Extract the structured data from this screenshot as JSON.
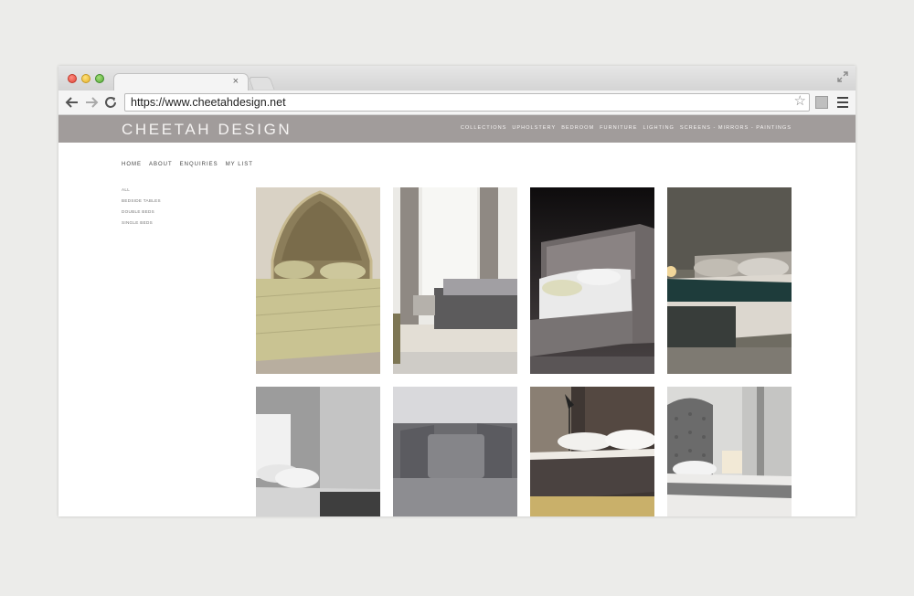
{
  "browser": {
    "url": "https://www.cheetahdesign.net",
    "tab_close": "×"
  },
  "site": {
    "logo": "CHEETAH DESIGN",
    "main_nav": [
      "COLLECTIONS",
      "UPHOLSTERY",
      "BEDROOM",
      "FURNITURE",
      "LIGHTING",
      "SCREENS - MIRRORS - PAINTINGS"
    ],
    "sub_nav": [
      "HOME",
      "ABOUT",
      "ENQUIRIES",
      "MY LIST"
    ],
    "filters": [
      "ALL",
      "BEDSIDE TABLES",
      "DOUBLE BEDS",
      "SINGLE BEDS"
    ]
  },
  "products": [
    {
      "name": "tufted-gold-headboard-bed"
    },
    {
      "name": "grey-bed-bright-room"
    },
    {
      "name": "dark-frame-bed"
    },
    {
      "name": "teal-throw-bed"
    },
    {
      "name": "white-headboard-bed"
    },
    {
      "name": "grey-cushions-bed"
    },
    {
      "name": "lamp-dark-headboard-bed"
    },
    {
      "name": "tall-tufted-grey-headboard-bed"
    }
  ]
}
